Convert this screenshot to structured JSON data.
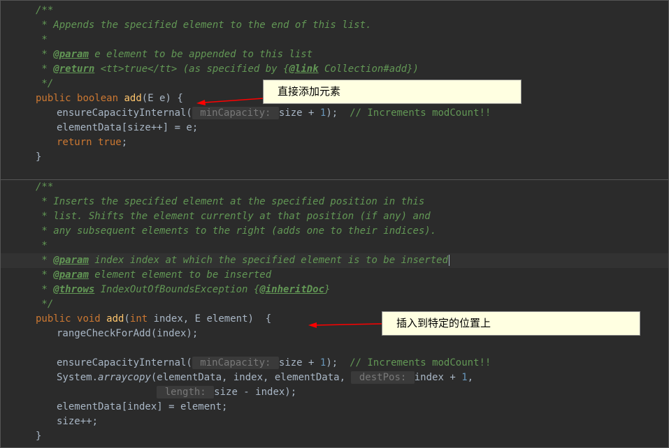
{
  "annotations": {
    "box1": "直接添加元素",
    "box2": "插入到特定的位置上"
  },
  "code_block1": {
    "javadoc_open": "/**",
    "line1": " * Appends the specified element to the end of this list.",
    "line2": " *",
    "param_tag": "@param",
    "param_text": " e element to be appended to this list",
    "return_tag": "@return",
    "return_text1": " <tt>true</tt> (as specified by {",
    "link_tag": "@link",
    "return_text2": " Collection#add})",
    "javadoc_close": " */",
    "method_sig": {
      "modifier": "public",
      "return_type": "boolean",
      "name": "add",
      "params": "(E e) {"
    },
    "body1_pre": "ensureCapacityInternal(",
    "body1_hint": " minCapacity: ",
    "body1_post": "size + ",
    "body1_num": "1",
    "body1_end": ");  ",
    "body1_comment": "// Increments modCount!!",
    "body2": "elementData[size++] = e;",
    "body3_kw": "return",
    "body3_val": " true",
    "body3_end": ";",
    "close": "}"
  },
  "code_block2": {
    "javadoc_open": "/**",
    "line1": " * Inserts the specified element at the specified position in this",
    "line2": " * list. Shifts the element currently at that position (if any) and",
    "line3": " * any subsequent elements to the right (adds one to their indices).",
    "line4": " *",
    "param_tag": "@param",
    "param1_text": " index index at which the specified element is to be inserted",
    "param2_text": " element element to be inserted",
    "throws_tag": "@throws",
    "throws_text1": " IndexOutOfBoundsException {",
    "inherit_tag": "@inheritDoc",
    "throws_text2": "}",
    "javadoc_close": " */",
    "method_sig": {
      "modifier": "public",
      "return_type": "void",
      "name": "add",
      "params_pre": "(",
      "int_kw": "int",
      "params_mid": " index, E element)  {"
    },
    "body1": "rangeCheckForAdd(index);",
    "body2_pre": "ensureCapacityInternal(",
    "body2_hint": " minCapacity: ",
    "body2_post": "size + ",
    "body2_num": "1",
    "body2_end": ");  ",
    "body2_comment": "// Increments modCount!!",
    "body3_pre": "System.",
    "body3_method": "arraycopy",
    "body3_args1": "(elementData, index, elementData, ",
    "body3_hint1": " destPos: ",
    "body3_args2": "index + ",
    "body3_num1": "1",
    "body3_args3": ",",
    "body4_hint": " length: ",
    "body4_args": "size - index);",
    "body5": "elementData[index] = element;",
    "body6": "size++;",
    "close": "}"
  }
}
